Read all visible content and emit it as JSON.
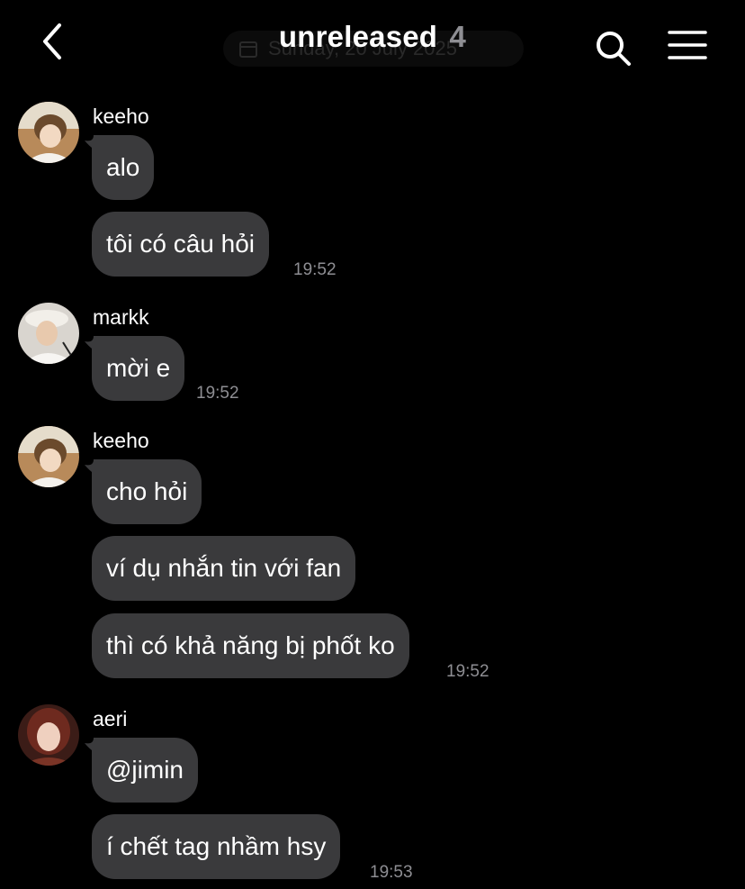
{
  "header": {
    "title": "unreleased",
    "count": "4",
    "date_ghost": "Sunday, 20 July 2025"
  },
  "messages": [
    {
      "sender": "keeho",
      "lines": [
        "alo",
        "tôi có câu hỏi"
      ],
      "time": "19:52"
    },
    {
      "sender": "markk",
      "lines": [
        "mời e"
      ],
      "time": "19:52"
    },
    {
      "sender": "keeho",
      "lines": [
        "cho hỏi",
        "ví dụ nhắn tin với fan",
        "thì có khả năng bị phốt ko"
      ],
      "time": "19:52"
    },
    {
      "sender": "aeri",
      "lines": [
        "@jimin",
        "í chết tag nhầm hsy"
      ],
      "time": "19:53"
    }
  ],
  "colors": {
    "background": "#000000",
    "bubble": "#3a3a3c",
    "secondary_text": "#8e8e93"
  },
  "icons": {
    "back": "chevron-left-icon",
    "search": "search-icon",
    "menu": "hamburger-menu-icon",
    "calendar": "calendar-icon"
  }
}
